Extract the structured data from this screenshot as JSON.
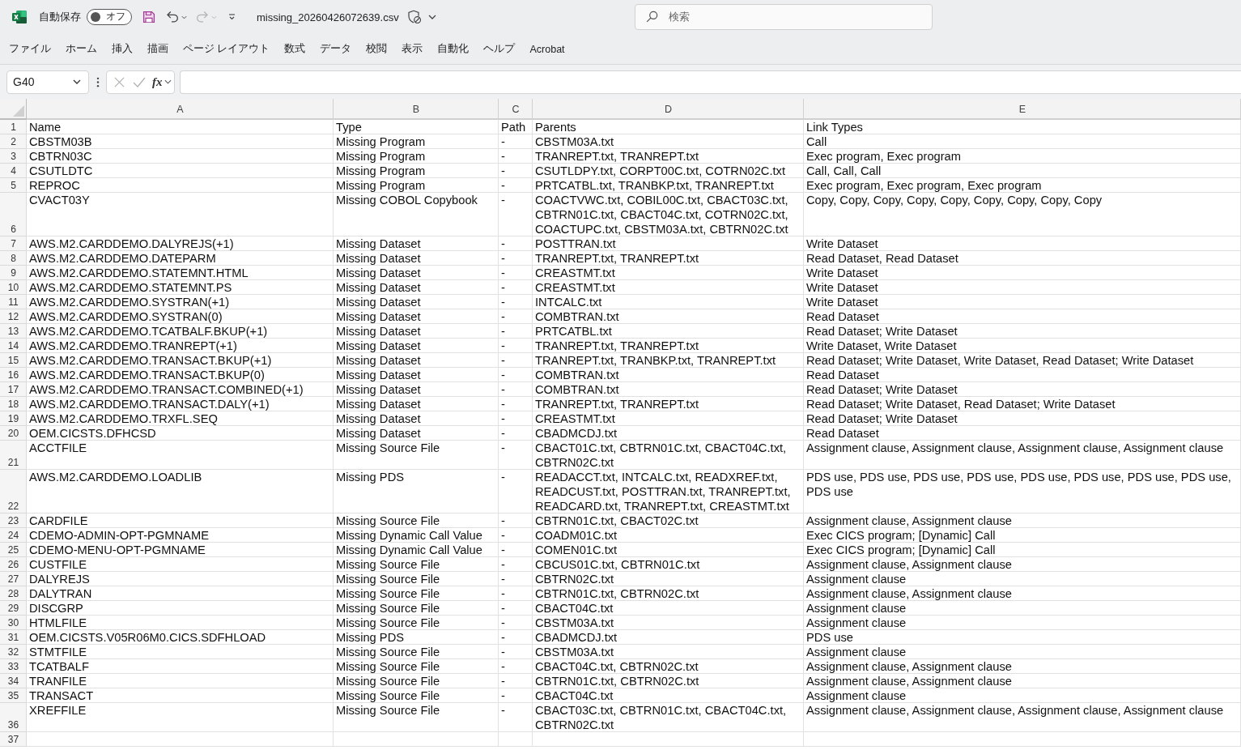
{
  "title_bar": {
    "autosave": {
      "label": "自動保存",
      "on": false,
      "state_label": "オフ"
    },
    "undo": {
      "disabled": false
    },
    "redo": {
      "disabled": true
    },
    "file_name": "missing_20260426072639.csv"
  },
  "search": {
    "placeholder": "検索"
  },
  "ribbon_tabs": [
    {
      "label": "ファイル",
      "selected": false
    },
    {
      "label": "ホーム",
      "selected": false
    },
    {
      "label": "挿入",
      "selected": false
    },
    {
      "label": "描画",
      "selected": false
    },
    {
      "label": "ページ レイアウト",
      "selected": false
    },
    {
      "label": "数式",
      "selected": false
    },
    {
      "label": "データ",
      "selected": false
    },
    {
      "label": "校閲",
      "selected": false
    },
    {
      "label": "表示",
      "selected": false
    },
    {
      "label": "自動化",
      "selected": false
    },
    {
      "label": "ヘルプ",
      "selected": false
    },
    {
      "label": "Acrobat",
      "selected": false
    }
  ],
  "formula_bar": {
    "name_box": "G40",
    "cancel": {
      "disabled": true
    },
    "enter": {
      "disabled": true
    },
    "function_label": "fx"
  },
  "sheet": {
    "columns": [
      "A",
      "B",
      "C",
      "D",
      "E"
    ],
    "rows": [
      {
        "number": "1",
        "cells": [
          "Name",
          "Type",
          "Path",
          "Parents",
          "Link Types"
        ]
      },
      {
        "number": "2",
        "cells": [
          "CBSTM03B",
          "Missing Program",
          "-",
          "CBSTM03A.txt",
          "Call"
        ]
      },
      {
        "number": "3",
        "cells": [
          "CBTRN03C",
          "Missing Program",
          "-",
          "TRANREPT.txt, TRANREPT.txt",
          "Exec program, Exec program"
        ]
      },
      {
        "number": "4",
        "cells": [
          "CSUTLDTC",
          "Missing Program",
          "-",
          "CSUTLDPY.txt, CORPT00C.txt, COTRN02C.txt",
          "Call, Call, Call"
        ]
      },
      {
        "number": "5",
        "cells": [
          "REPROC",
          "Missing Program",
          "-",
          "PRTCATBL.txt, TRANBKP.txt, TRANREPT.txt",
          "Exec program, Exec program, Exec program"
        ]
      },
      {
        "number": "6",
        "cells": [
          "CVACT03Y",
          "Missing COBOL Copybook",
          "-",
          "COACTVWC.txt, COBIL00C.txt, CBACT03C.txt, CBTRN01C.txt, CBACT04C.txt, COTRN02C.txt, COACTUPC.txt, CBSTM03A.txt, CBTRN02C.txt",
          "Copy, Copy, Copy, Copy, Copy, Copy, Copy, Copy, Copy"
        ]
      },
      {
        "number": "7",
        "cells": [
          "AWS.M2.CARDDEMO.DALYREJS(+1)",
          "Missing Dataset",
          "-",
          "POSTTRAN.txt",
          "Write Dataset"
        ]
      },
      {
        "number": "8",
        "cells": [
          "AWS.M2.CARDDEMO.DATEPARM",
          "Missing Dataset",
          "-",
          "TRANREPT.txt, TRANREPT.txt",
          "Read Dataset, Read Dataset"
        ]
      },
      {
        "number": "9",
        "cells": [
          "AWS.M2.CARDDEMO.STATEMNT.HTML",
          "Missing Dataset",
          "-",
          "CREASTMT.txt",
          "Write Dataset"
        ]
      },
      {
        "number": "10",
        "cells": [
          "AWS.M2.CARDDEMO.STATEMNT.PS",
          "Missing Dataset",
          "-",
          "CREASTMT.txt",
          "Write Dataset"
        ]
      },
      {
        "number": "11",
        "cells": [
          "AWS.M2.CARDDEMO.SYSTRAN(+1)",
          "Missing Dataset",
          "-",
          "INTCALC.txt",
          "Write Dataset"
        ]
      },
      {
        "number": "12",
        "cells": [
          "AWS.M2.CARDDEMO.SYSTRAN(0)",
          "Missing Dataset",
          "-",
          "COMBTRAN.txt",
          "Read Dataset"
        ]
      },
      {
        "number": "13",
        "cells": [
          "AWS.M2.CARDDEMO.TCATBALF.BKUP(+1)",
          "Missing Dataset",
          "-",
          "PRTCATBL.txt",
          "Read Dataset; Write Dataset"
        ]
      },
      {
        "number": "14",
        "cells": [
          "AWS.M2.CARDDEMO.TRANREPT(+1)",
          "Missing Dataset",
          "-",
          "TRANREPT.txt, TRANREPT.txt",
          "Write Dataset, Write Dataset"
        ]
      },
      {
        "number": "15",
        "cells": [
          "AWS.M2.CARDDEMO.TRANSACT.BKUP(+1)",
          "Missing Dataset",
          "-",
          "TRANREPT.txt, TRANBKP.txt, TRANREPT.txt",
          "Read Dataset; Write Dataset, Write Dataset, Read Dataset; Write Dataset"
        ]
      },
      {
        "number": "16",
        "cells": [
          "AWS.M2.CARDDEMO.TRANSACT.BKUP(0)",
          "Missing Dataset",
          "-",
          "COMBTRAN.txt",
          "Read Dataset"
        ]
      },
      {
        "number": "17",
        "cells": [
          "AWS.M2.CARDDEMO.TRANSACT.COMBINED(+1)",
          "Missing Dataset",
          "-",
          "COMBTRAN.txt",
          "Read Dataset; Write Dataset"
        ]
      },
      {
        "number": "18",
        "cells": [
          "AWS.M2.CARDDEMO.TRANSACT.DALY(+1)",
          "Missing Dataset",
          "-",
          "TRANREPT.txt, TRANREPT.txt",
          "Read Dataset; Write Dataset, Read Dataset; Write Dataset"
        ]
      },
      {
        "number": "19",
        "cells": [
          "AWS.M2.CARDDEMO.TRXFL.SEQ",
          "Missing Dataset",
          "-",
          "CREASTMT.txt",
          "Read Dataset; Write Dataset"
        ]
      },
      {
        "number": "20",
        "cells": [
          "OEM.CICSTS.DFHCSD",
          "Missing Dataset",
          "-",
          "CBADMCDJ.txt",
          "Read Dataset"
        ]
      },
      {
        "number": "21",
        "cells": [
          "ACCTFILE",
          "Missing Source File",
          "-",
          "CBACT01C.txt, CBTRN01C.txt, CBACT04C.txt, CBTRN02C.txt",
          "Assignment clause, Assignment clause, Assignment clause, Assignment clause"
        ]
      },
      {
        "number": "22",
        "cells": [
          "AWS.M2.CARDDEMO.LOADLIB",
          "Missing PDS",
          "-",
          "READACCT.txt, INTCALC.txt, READXREF.txt, READCUST.txt, POSTTRAN.txt, TRANREPT.txt, READCARD.txt, TRANREPT.txt, CREASTMT.txt",
          "PDS use, PDS use, PDS use, PDS use, PDS use, PDS use, PDS use, PDS use, PDS use"
        ]
      },
      {
        "number": "23",
        "cells": [
          "CARDFILE",
          "Missing Source File",
          "-",
          "CBTRN01C.txt, CBACT02C.txt",
          "Assignment clause, Assignment clause"
        ]
      },
      {
        "number": "24",
        "cells": [
          "CDEMO-ADMIN-OPT-PGMNAME",
          "Missing Dynamic Call Value",
          "-",
          "COADM01C.txt",
          "Exec CICS program; [Dynamic] Call"
        ]
      },
      {
        "number": "25",
        "cells": [
          "CDEMO-MENU-OPT-PGMNAME",
          "Missing Dynamic Call Value",
          "-",
          "COMEN01C.txt",
          "Exec CICS program; [Dynamic] Call"
        ]
      },
      {
        "number": "26",
        "cells": [
          "CUSTFILE",
          "Missing Source File",
          "-",
          "CBCUS01C.txt, CBTRN01C.txt",
          "Assignment clause, Assignment clause"
        ]
      },
      {
        "number": "27",
        "cells": [
          "DALYREJS",
          "Missing Source File",
          "-",
          "CBTRN02C.txt",
          "Assignment clause"
        ]
      },
      {
        "number": "28",
        "cells": [
          "DALYTRAN",
          "Missing Source File",
          "-",
          "CBTRN01C.txt, CBTRN02C.txt",
          "Assignment clause, Assignment clause"
        ]
      },
      {
        "number": "29",
        "cells": [
          "DISCGRP",
          "Missing Source File",
          "-",
          "CBACT04C.txt",
          "Assignment clause"
        ]
      },
      {
        "number": "30",
        "cells": [
          "HTMLFILE",
          "Missing Source File",
          "-",
          "CBSTM03A.txt",
          "Assignment clause"
        ]
      },
      {
        "number": "31",
        "cells": [
          "OEM.CICSTS.V05R06M0.CICS.SDFHLOAD",
          "Missing PDS",
          "-",
          "CBADMCDJ.txt",
          "PDS use"
        ]
      },
      {
        "number": "32",
        "cells": [
          "STMTFILE",
          "Missing Source File",
          "-",
          "CBSTM03A.txt",
          "Assignment clause"
        ]
      },
      {
        "number": "33",
        "cells": [
          "TCATBALF",
          "Missing Source File",
          "-",
          "CBACT04C.txt, CBTRN02C.txt",
          "Assignment clause, Assignment clause"
        ]
      },
      {
        "number": "34",
        "cells": [
          "TRANFILE",
          "Missing Source File",
          "-",
          "CBTRN01C.txt, CBTRN02C.txt",
          "Assignment clause, Assignment clause"
        ]
      },
      {
        "number": "35",
        "cells": [
          "TRANSACT",
          "Missing Source File",
          "-",
          "CBACT04C.txt",
          "Assignment clause"
        ]
      },
      {
        "number": "36",
        "cells": [
          "XREFFILE",
          "Missing Source File",
          "-",
          "CBACT03C.txt, CBTRN01C.txt, CBACT04C.txt, CBTRN02C.txt",
          "Assignment clause, Assignment clause, Assignment clause, Assignment clause"
        ]
      },
      {
        "number": "37"
      }
    ]
  }
}
